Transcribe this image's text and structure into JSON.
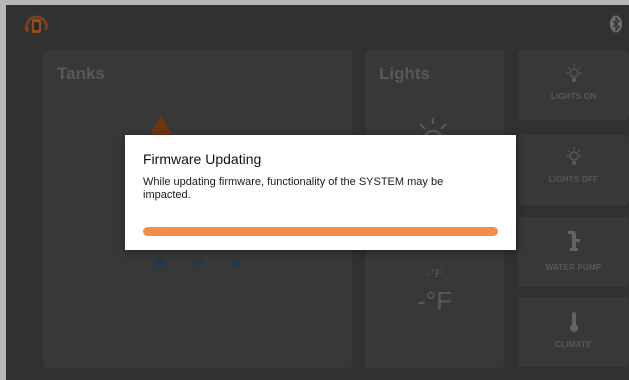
{
  "app": {
    "panels": {
      "tanks": {
        "title": "Tanks"
      },
      "lights": {
        "title": "Lights",
        "temp_small": "-°F",
        "temp_large": "-°F"
      }
    },
    "tiles": [
      {
        "label": "LIGHTS ON",
        "icon": "bulb-icon"
      },
      {
        "label": "LIGHTS OFF",
        "icon": "bulb-icon"
      },
      {
        "label": "WATER PUMP",
        "icon": "water-pump-icon"
      },
      {
        "label": "CLIMATE",
        "icon": "thermometer-icon"
      }
    ]
  },
  "dialog": {
    "title": "Firmware Updating",
    "message": "While updating firmware, functionality of the SYSTEM may be impacted.",
    "progress": 1.0
  },
  "colors": {
    "accent": "#f48d48",
    "background": "#454545",
    "panel": "#4e4e4e"
  }
}
